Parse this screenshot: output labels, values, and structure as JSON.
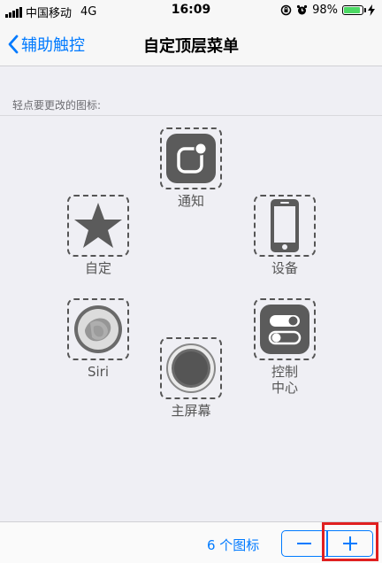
{
  "status_bar": {
    "carrier": "中国移动",
    "network": "4G",
    "time": "16:09",
    "battery_percent": 98,
    "battery_text": "98%",
    "icons": [
      "signal-icon",
      "rotation-lock-icon",
      "alarm-icon",
      "battery-icon",
      "charging-icon"
    ]
  },
  "nav": {
    "back_label": "辅助触控",
    "title": "自定顶层菜单"
  },
  "section": {
    "hint": "轻点要更改的图标:"
  },
  "icons": [
    {
      "id": "notifications",
      "label": "通知",
      "icon": "notification-icon"
    },
    {
      "id": "custom",
      "label": "自定",
      "icon": "star-icon"
    },
    {
      "id": "device",
      "label": "设备",
      "icon": "phone-icon"
    },
    {
      "id": "siri",
      "label": "Siri",
      "icon": "siri-icon"
    },
    {
      "id": "control-center",
      "label": "控制\n中心",
      "icon": "toggle-icon"
    },
    {
      "id": "home",
      "label": "主屏幕",
      "icon": "home-button-icon"
    }
  ],
  "footer": {
    "count_label": "6 个图标"
  },
  "colors": {
    "accent": "#007aff",
    "battery": "#4cd964",
    "tile": "#5b5b5b",
    "highlight": "#e02020"
  }
}
